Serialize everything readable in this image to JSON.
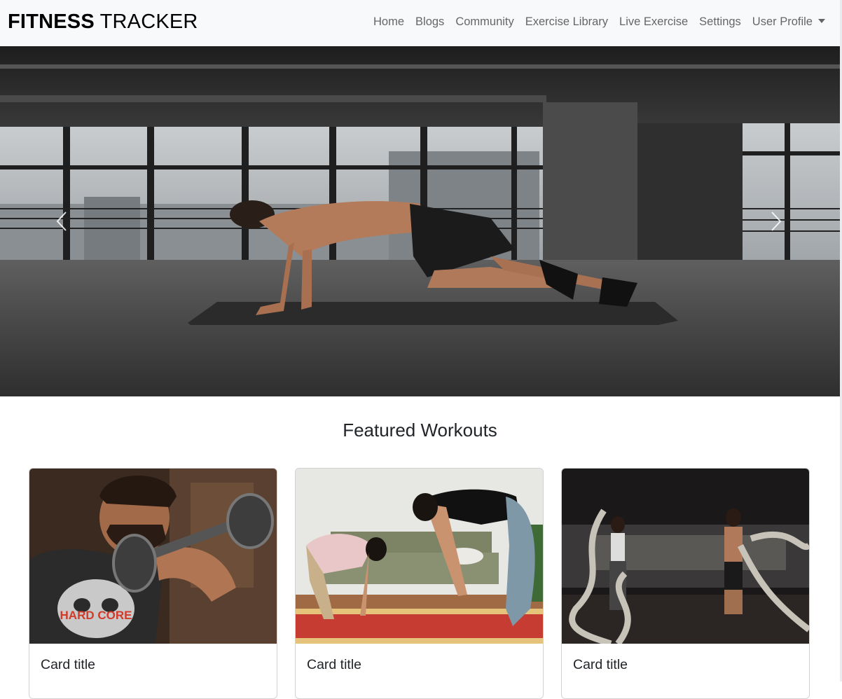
{
  "navbar": {
    "brand_bold": "FITNESS",
    "brand_rest": " TRACKER",
    "links": [
      "Home",
      "Blogs",
      "Community",
      "Exercise Library",
      "Live Exercise",
      "Settings"
    ],
    "user_profile_label": "User Profile"
  },
  "hero": {
    "prev_icon": "chevron-left-icon",
    "next_icon": "chevron-right-icon"
  },
  "featured": {
    "title": "Featured Workouts",
    "cards": [
      {
        "title": "Card title",
        "image_text": "HARD CORE"
      },
      {
        "title": "Card title"
      },
      {
        "title": "Card title"
      }
    ]
  }
}
